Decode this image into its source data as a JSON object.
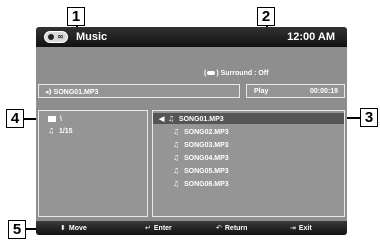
{
  "callouts": [
    "1",
    "2",
    "3",
    "4",
    "5"
  ],
  "topbar": {
    "title": "Music",
    "clock": "12:00 AM",
    "logo_icon": "disc-infinity-logo"
  },
  "surround": {
    "label": "Surround : Off"
  },
  "now_playing": {
    "track": "SONG01.MP3",
    "icon": "speaker-icon"
  },
  "status": {
    "mode": "Play",
    "time": "00:00:19"
  },
  "folder": {
    "path": "\\",
    "count": "1/15"
  },
  "tracks": [
    {
      "label": "SONG01.MP3",
      "selected": true
    },
    {
      "label": "SONG02.MP3",
      "selected": false
    },
    {
      "label": "SONG03.MP3",
      "selected": false
    },
    {
      "label": "SONG04.MP3",
      "selected": false
    },
    {
      "label": "SONG05.MP3",
      "selected": false
    },
    {
      "label": "SONG06.MP3",
      "selected": false
    }
  ],
  "bottombar": {
    "move": "Move",
    "enter": "Enter",
    "return": "Return",
    "exit": "Exit"
  }
}
